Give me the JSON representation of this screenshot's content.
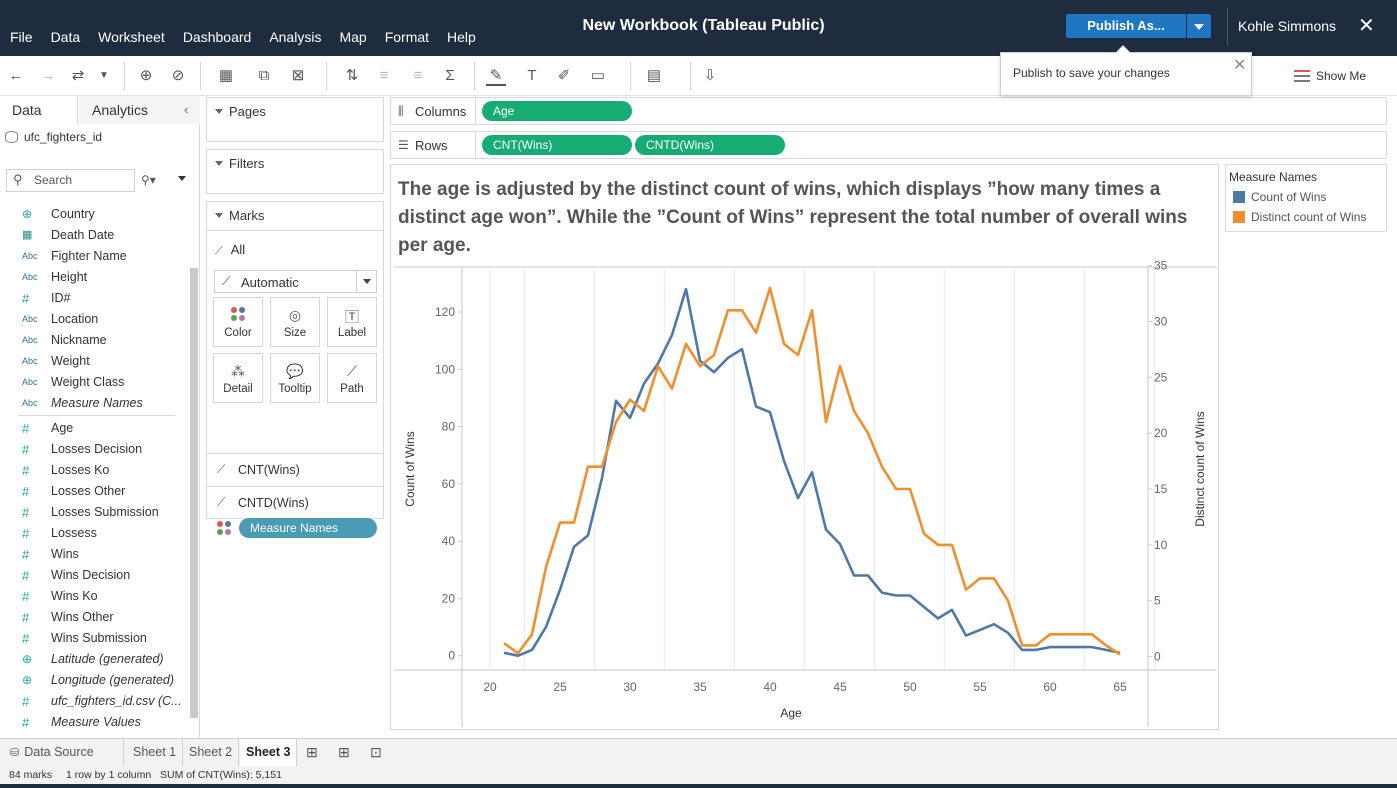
{
  "window": {
    "title": "New Workbook (Tableau Public)",
    "menu": [
      "File",
      "Data",
      "Worksheet",
      "Dashboard",
      "Analysis",
      "Map",
      "Format",
      "Help"
    ],
    "publish_label": "Publish As...",
    "user": "Kohle Simmons",
    "close_glyph": "✕"
  },
  "toolbar": {
    "publish_tip": "Publish to save your changes",
    "show_me": "Show Me"
  },
  "data_pane": {
    "tab_data": "Data",
    "tab_analytics": "Analytics",
    "datasource": "ufc_fighters_id",
    "search_placeholder": "Search",
    "dimensions": [
      {
        "icon": "globe",
        "name": "Country"
      },
      {
        "icon": "calendar",
        "name": "Death Date"
      },
      {
        "icon": "abc",
        "name": "Fighter Name"
      },
      {
        "icon": "abc",
        "name": "Height"
      },
      {
        "icon": "hash",
        "name": "ID#"
      },
      {
        "icon": "abc",
        "name": "Location"
      },
      {
        "icon": "abc",
        "name": "Nickname"
      },
      {
        "icon": "abc",
        "name": "Weight"
      },
      {
        "icon": "abc",
        "name": "Weight Class"
      },
      {
        "icon": "abc",
        "name": "Measure Names",
        "italic": true
      }
    ],
    "measures": [
      {
        "icon": "hash",
        "name": "Age"
      },
      {
        "icon": "hash",
        "name": "Losses Decision"
      },
      {
        "icon": "hash",
        "name": "Losses Ko"
      },
      {
        "icon": "hash",
        "name": "Losses Other"
      },
      {
        "icon": "hash",
        "name": "Losses Submission"
      },
      {
        "icon": "hash",
        "name": "Lossess"
      },
      {
        "icon": "hash",
        "name": "Wins"
      },
      {
        "icon": "hash",
        "name": "Wins Decision"
      },
      {
        "icon": "hash",
        "name": "Wins Ko"
      },
      {
        "icon": "hash",
        "name": "Wins Other"
      },
      {
        "icon": "hash",
        "name": "Wins Submission"
      },
      {
        "icon": "globe",
        "name": "Latitude (generated)",
        "italic": true
      },
      {
        "icon": "globe",
        "name": "Longitude (generated)",
        "italic": true
      },
      {
        "icon": "hash",
        "name": "ufc_fighters_id.csv (C...",
        "italic": true
      },
      {
        "icon": "hash",
        "name": "Measure Values",
        "italic": true
      }
    ]
  },
  "cards": {
    "pages": "Pages",
    "filters": "Filters",
    "marks": "Marks",
    "marks_all": "All",
    "mark_type": "Automatic",
    "buttons": {
      "color": "Color",
      "size": "Size",
      "label": "Label",
      "detail": "Detail",
      "tooltip": "Tooltip",
      "path": "Path"
    },
    "measure_pill": "Measure Names",
    "mark_rows": [
      "CNT(Wins)",
      "CNTD(Wins)"
    ]
  },
  "shelves": {
    "columns_label": "Columns",
    "rows_label": "Rows",
    "columns_pills": [
      "Age"
    ],
    "rows_pills": [
      "CNT(Wins)",
      "CNTD(Wins)"
    ]
  },
  "sheet_title": "The age is adjusted by the distinct count of wins, which displays ”how many times a distinct age won”.  While the ”Count of Wins” represent the total number of overall wins per age.",
  "legend": {
    "title": "Measure Names",
    "items": [
      {
        "name": "Count of Wins",
        "color": "#4e79a7"
      },
      {
        "name": "Distinct count of Wins",
        "color": "#f28e2b"
      }
    ]
  },
  "chart_data": {
    "type": "line",
    "xlabel": "Age",
    "ylabel": "Count of Wins",
    "y2label": "Distinct count of Wins",
    "xlim": [
      18,
      67
    ],
    "ylim": [
      -5,
      135
    ],
    "y2lim": [
      -1.2,
      34.7
    ],
    "xticks": [
      20,
      25,
      30,
      35,
      40,
      45,
      50,
      55,
      60,
      65
    ],
    "yticks": [
      0,
      20,
      40,
      60,
      80,
      100,
      120
    ],
    "y2ticks": [
      0,
      5,
      10,
      15,
      20,
      25,
      30,
      35
    ],
    "series": [
      {
        "name": "Count of Wins",
        "color": "#4e79a7",
        "axis": "left",
        "x": [
          21,
          22,
          23,
          24,
          25,
          26,
          27,
          28,
          29,
          30,
          31,
          32,
          33,
          34,
          35,
          36,
          37,
          38,
          39,
          40,
          41,
          42,
          43,
          44,
          45,
          46,
          47,
          48,
          49,
          50,
          51,
          52,
          53,
          54,
          55,
          56,
          57,
          58,
          59,
          60,
          61,
          62,
          63,
          64,
          65
        ],
        "values": [
          1,
          0,
          2,
          10,
          23,
          38,
          42,
          62,
          89,
          83,
          95,
          102,
          112,
          128,
          103,
          99,
          104,
          107,
          87,
          85,
          68,
          55,
          64,
          44,
          39,
          28,
          28,
          22,
          21,
          21,
          17,
          13,
          16,
          7,
          9,
          11,
          8,
          2,
          2,
          3,
          3,
          3,
          3,
          2,
          1
        ]
      },
      {
        "name": "Distinct count of Wins",
        "color": "#f28e2b",
        "axis": "right",
        "x": [
          21,
          22,
          23,
          24,
          25,
          26,
          27,
          28,
          29,
          30,
          31,
          32,
          33,
          34,
          35,
          36,
          37,
          38,
          39,
          40,
          41,
          42,
          43,
          44,
          45,
          46,
          47,
          48,
          49,
          50,
          51,
          52,
          53,
          54,
          55,
          56,
          57,
          58,
          59,
          60,
          61,
          62,
          63,
          64,
          65
        ],
        "values": [
          1.2,
          0.3,
          2,
          8,
          12,
          12,
          17,
          17,
          21,
          23,
          22,
          26,
          24,
          28,
          26,
          27,
          31,
          31,
          29,
          33,
          28,
          27,
          31,
          21,
          26,
          22,
          20,
          17,
          15,
          15,
          11,
          10,
          10,
          6,
          7,
          7,
          5,
          1,
          1,
          2,
          2,
          2,
          2,
          1,
          0.2
        ]
      }
    ]
  },
  "tabs": {
    "data_source": "Data Source",
    "sheets": [
      "Sheet 1",
      "Sheet 2",
      "Sheet 3"
    ],
    "active": "Sheet 3"
  },
  "status": {
    "marks": "84 marks",
    "dims": "1 row by 1 column",
    "sum": "SUM of CNT(Wins): 5,151"
  }
}
